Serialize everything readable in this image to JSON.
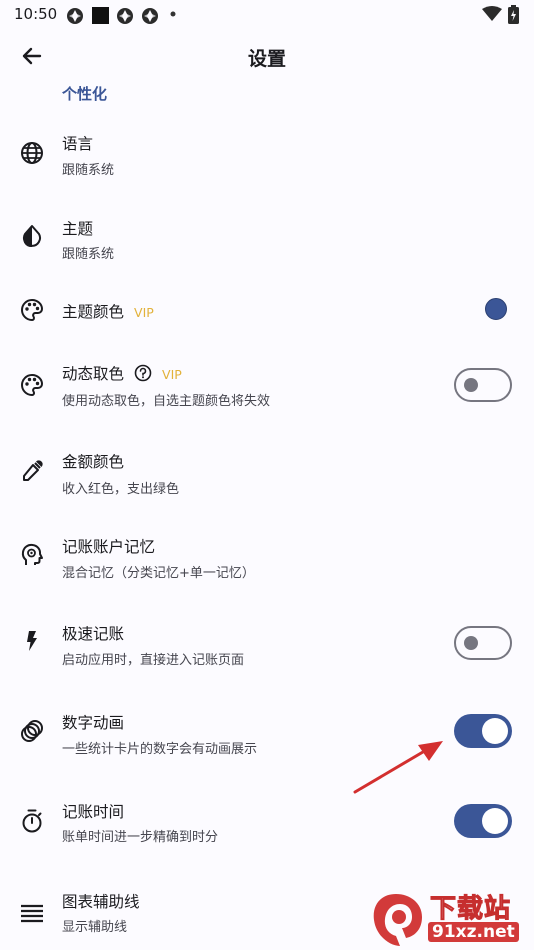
{
  "status_bar": {
    "time": "10:50"
  },
  "header": {
    "title": "设置"
  },
  "section_title": "个性化",
  "vip_label": "VIP",
  "rows": [
    {
      "title": "语言",
      "subtitle": "跟随系统"
    },
    {
      "title": "主题",
      "subtitle": "跟随系统"
    },
    {
      "title": "主题颜色"
    },
    {
      "title": "动态取色",
      "subtitle": "使用动态取色，自选主题颜色将失效"
    },
    {
      "title": "金额颜色",
      "subtitle": "收入红色，支出绿色"
    },
    {
      "title": "记账账户记忆",
      "subtitle": "混合记忆（分类记忆+单一记忆）"
    },
    {
      "title": "极速记账",
      "subtitle": "启动应用时，直接进入记账页面"
    },
    {
      "title": "数字动画",
      "subtitle": "一些统计卡片的数字会有动画展示"
    },
    {
      "title": "记账时间",
      "subtitle": "账单时间进一步精确到时分"
    },
    {
      "title": "图表辅助线",
      "subtitle": "显示辅助线"
    }
  ],
  "toggles": {
    "dynamic_color": false,
    "quick_entry": false,
    "number_animation": true,
    "entry_time": true
  },
  "colors": {
    "accent": "#3B5697",
    "vip": "#E2B23B",
    "arrow": "#D32F2F"
  },
  "watermark": {
    "brand": "下载站",
    "url": "91xz.net"
  }
}
